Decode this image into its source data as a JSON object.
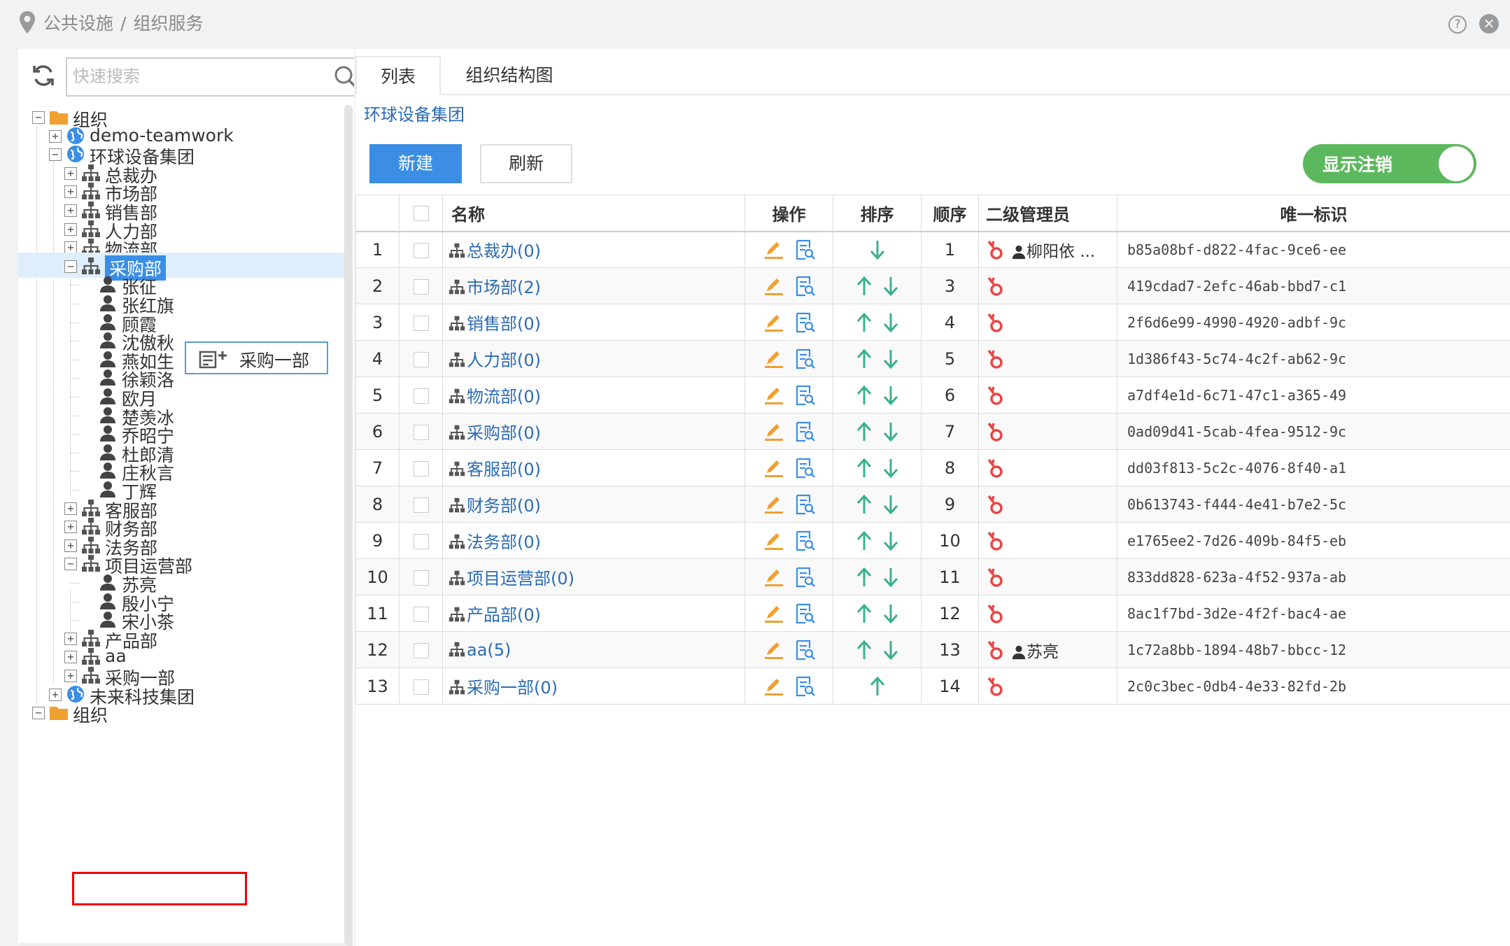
{
  "breadcrumb": {
    "part1": "公共设施",
    "separator": "/",
    "part2": "组织服务"
  },
  "window": {
    "help": "?",
    "close": "×"
  },
  "search": {
    "placeholder": "快速搜索",
    "value": ""
  },
  "tree": {
    "root1": "组织",
    "demo": "demo-teamwork",
    "group": "环球设备集团",
    "depts_top": [
      "总裁办",
      "市场部",
      "销售部",
      "人力部",
      "物流部"
    ],
    "selected": "采购部",
    "purchase_members": [
      "张征",
      "张红旗",
      "顾霞",
      "沈傲秋",
      "燕如生",
      "徐颖洛",
      "欧月",
      "楚羡冰",
      "乔昭宁",
      "杜郎清",
      "庄秋言",
      "丁辉"
    ],
    "depts_mid": [
      "客服部",
      "财务部",
      "法务部",
      "项目运营部"
    ],
    "project_members": [
      "苏亮",
      "殷小宁",
      "宋小茶"
    ],
    "depts_bottom": [
      "产品部",
      "aa",
      "采购一部"
    ],
    "group2": "未来科技集团",
    "root2": "组织"
  },
  "context_menu": {
    "label": "采购一部"
  },
  "tabs": {
    "list": "列表",
    "chart": "组织结构图"
  },
  "group_title": "环球设备集团",
  "toolbar": {
    "new": "新建",
    "refresh": "刷新",
    "toggle": "显示注销"
  },
  "colors": {
    "primary": "#3b8ee3",
    "toggle_on": "#5cb85c",
    "link": "#2a6bb5",
    "edit": "#f0a030",
    "arrow": "#3bb08f",
    "admin_icon": "#e84545"
  },
  "table": {
    "headers": {
      "name": "名称",
      "ops": "操作",
      "sort": "排序",
      "order": "顺序",
      "admin": "二级管理员",
      "uid": "唯一标识"
    },
    "rows": [
      {
        "idx": "1",
        "name": "总裁办(0)",
        "order": "1",
        "admin": "柳阳依 ...",
        "uid": "b85a08bf-d822-4fac-9ce6-ee",
        "up": false,
        "down": true
      },
      {
        "idx": "2",
        "name": "市场部(2)",
        "order": "3",
        "admin": "",
        "uid": "419cdad7-2efc-46ab-bbd7-c1",
        "up": true,
        "down": true
      },
      {
        "idx": "3",
        "name": "销售部(0)",
        "order": "4",
        "admin": "",
        "uid": "2f6d6e99-4990-4920-adbf-9c",
        "up": true,
        "down": true
      },
      {
        "idx": "4",
        "name": "人力部(0)",
        "order": "5",
        "admin": "",
        "uid": "1d386f43-5c74-4c2f-ab62-9c",
        "up": true,
        "down": true
      },
      {
        "idx": "5",
        "name": "物流部(0)",
        "order": "6",
        "admin": "",
        "uid": "a7df4e1d-6c71-47c1-a365-49",
        "up": true,
        "down": true
      },
      {
        "idx": "6",
        "name": "采购部(0)",
        "order": "7",
        "admin": "",
        "uid": "0ad09d41-5cab-4fea-9512-9c",
        "up": true,
        "down": true
      },
      {
        "idx": "7",
        "name": "客服部(0)",
        "order": "8",
        "admin": "",
        "uid": "dd03f813-5c2c-4076-8f40-a1",
        "up": true,
        "down": true
      },
      {
        "idx": "8",
        "name": "财务部(0)",
        "order": "9",
        "admin": "",
        "uid": "0b613743-f444-4e41-b7e2-5c",
        "up": true,
        "down": true
      },
      {
        "idx": "9",
        "name": "法务部(0)",
        "order": "10",
        "admin": "",
        "uid": "e1765ee2-7d26-409b-84f5-eb",
        "up": true,
        "down": true
      },
      {
        "idx": "10",
        "name": "项目运营部(0)",
        "order": "11",
        "admin": "",
        "uid": "833dd828-623a-4f52-937a-ab",
        "up": true,
        "down": true
      },
      {
        "idx": "11",
        "name": "产品部(0)",
        "order": "12",
        "admin": "",
        "uid": "8ac1f7bd-3d2e-4f2f-bac4-ae",
        "up": true,
        "down": true
      },
      {
        "idx": "12",
        "name": "aa(5)",
        "order": "13",
        "admin": "苏亮",
        "uid": "1c72a8bb-1894-48b7-bbcc-12",
        "up": true,
        "down": true
      },
      {
        "idx": "13",
        "name": "采购一部(0)",
        "order": "14",
        "admin": "",
        "uid": "2c0c3bec-0db4-4e33-82fd-2b",
        "up": true,
        "down": false
      }
    ]
  }
}
